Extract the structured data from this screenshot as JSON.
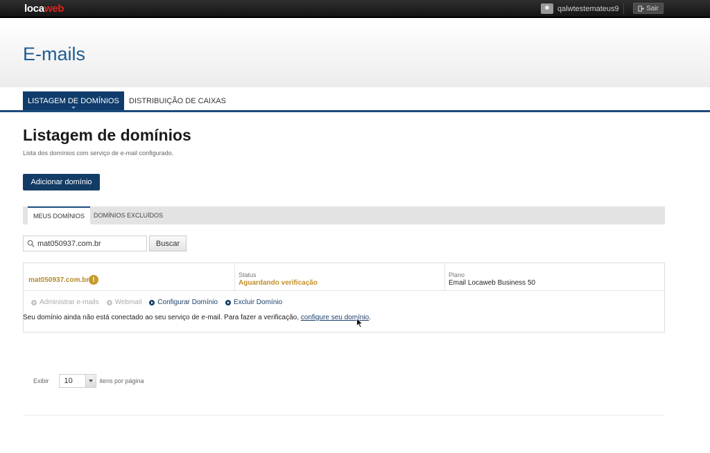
{
  "topbar": {
    "logo_part1": "loca",
    "logo_part2": "web",
    "username": "qalwtestemateus9",
    "logout_label": "Sair"
  },
  "header": {
    "title": "E-mails"
  },
  "main_tabs": [
    {
      "label": "LISTAGEM DE DOMÍNIOS",
      "active": true
    },
    {
      "label": "DISTRIBUIÇÃO DE CAIXAS",
      "active": false
    }
  ],
  "section": {
    "title": "Listagem de domínios",
    "description": "Lista dos domínios com serviço de e-mail configurado.",
    "add_button": "Adicionar domínio"
  },
  "sub_tabs": [
    {
      "label": "MEUS DOMÍNIOS",
      "active": true
    },
    {
      "label": "DOMÍNIOS EXCLUÍDOS",
      "active": false
    }
  ],
  "search": {
    "value": "mat050937.com.br",
    "button": "Buscar"
  },
  "domain": {
    "name": "mat050937.com.br",
    "warning": "!",
    "status_label": "Status",
    "status_value": "Aguardando verificação",
    "plan_label": "Plano",
    "plan_value": "Email Locaweb Business 50",
    "actions": [
      {
        "label": "Administrar e-mails",
        "enabled": false
      },
      {
        "label": "Webmail",
        "enabled": false
      },
      {
        "label": "Configurar Domínio",
        "enabled": true
      },
      {
        "label": "Excluir Domínio",
        "enabled": true
      }
    ],
    "notice_text": "Seu domínio ainda não está conectado ao seu serviço de e-mail. Para fazer a verificação,",
    "notice_link": "configure seu domínio",
    "notice_end": "."
  },
  "paging": {
    "show_label": "Exibir",
    "per_page_value": "10",
    "per_page_suffix": "itens por página"
  },
  "colors": {
    "brand_blue": "#123c66",
    "title_blue": "#1f5b92",
    "status_amber": "#c0902c",
    "logo_red": "#e2231a"
  }
}
